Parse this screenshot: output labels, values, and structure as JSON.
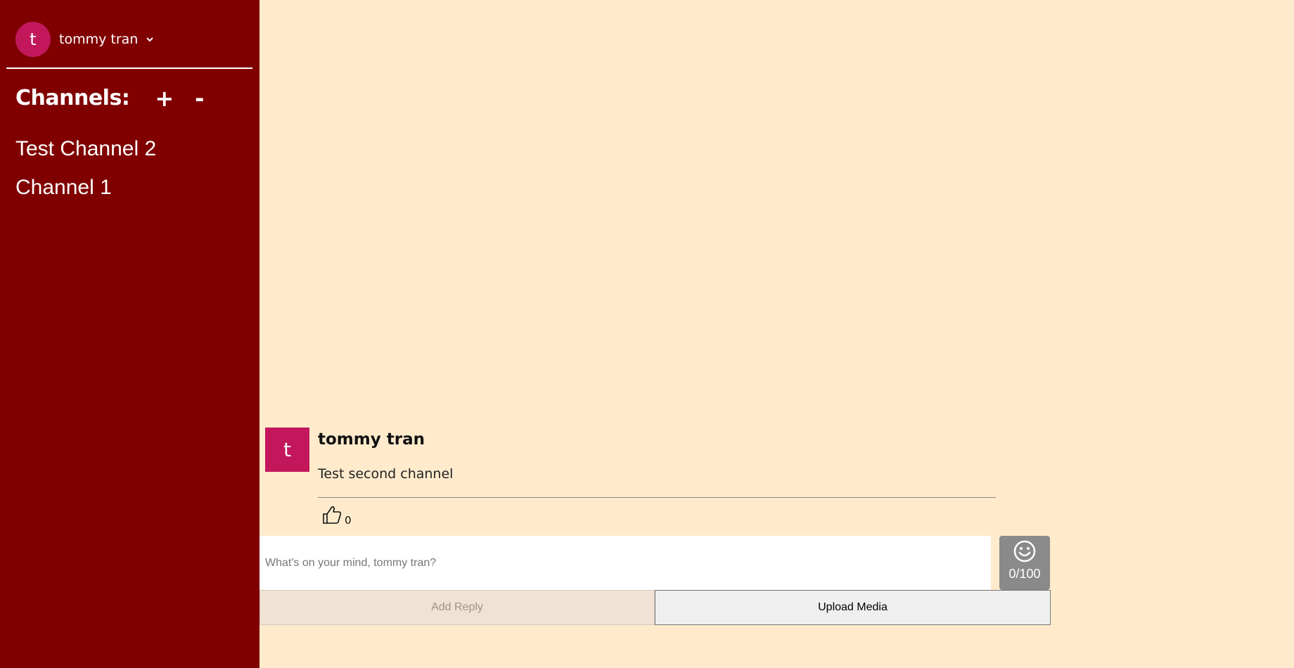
{
  "user": {
    "initial": "t",
    "name": "tommy tran"
  },
  "channels": {
    "title": "Channels:",
    "add_label": "+",
    "remove_label": "-",
    "items": [
      {
        "label": "Test Channel 2"
      },
      {
        "label": "Channel 1"
      }
    ]
  },
  "message": {
    "avatar_initial": "t",
    "author": "tommy tran",
    "text": "Test second channel",
    "like_count": "0"
  },
  "composer": {
    "placeholder": "What's on your mind, tommy tran?",
    "value": "",
    "char_count": "0/100",
    "add_reply_label": "Add Reply",
    "upload_label": "Upload Media"
  },
  "colors": {
    "sidebar_bg": "#800000",
    "main_bg": "#ffebcc",
    "avatar_bg": "#c2185b",
    "emoji_box_bg": "#8a8a8a"
  },
  "icons": {
    "user_menu": "chevron-down-icon",
    "like": "thumbs-up-icon",
    "emoji": "smiley-icon"
  }
}
